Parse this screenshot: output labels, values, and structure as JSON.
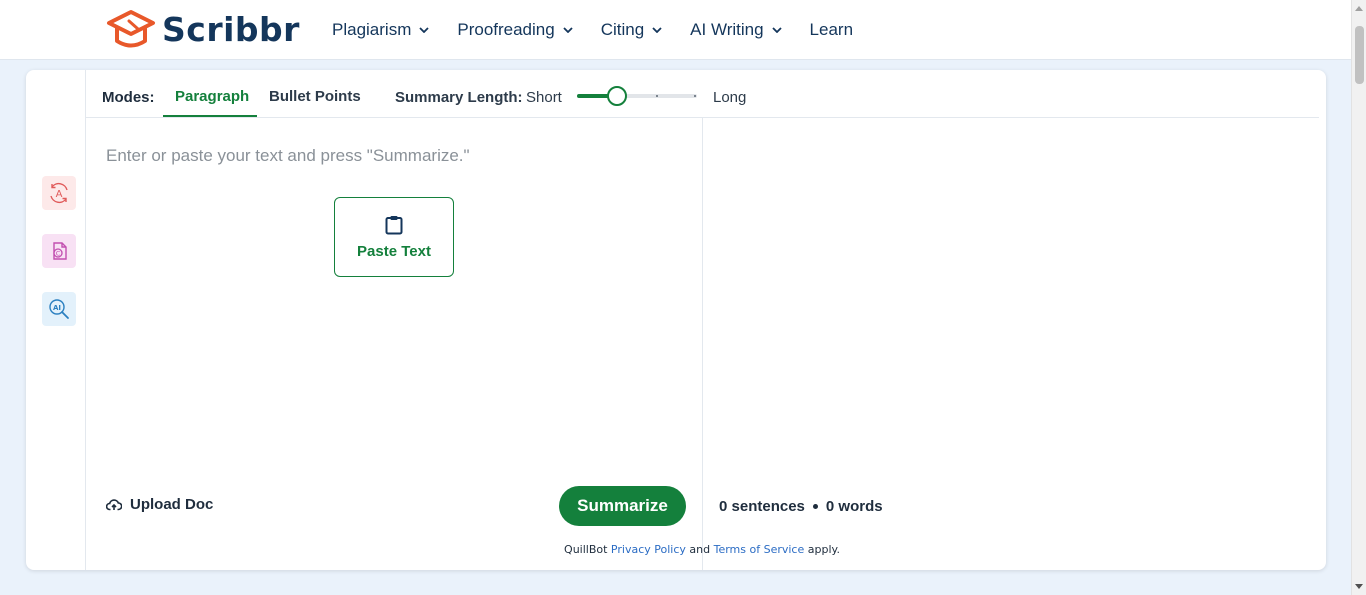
{
  "brand": {
    "name": "Scribbr",
    "logo_color": "#e8582a",
    "text_color": "#14365b"
  },
  "nav": [
    {
      "label": "Plagiarism",
      "has_dropdown": true
    },
    {
      "label": "Proofreading",
      "has_dropdown": true
    },
    {
      "label": "Citing",
      "has_dropdown": true
    },
    {
      "label": "AI Writing",
      "has_dropdown": true
    },
    {
      "label": "Learn",
      "has_dropdown": false
    }
  ],
  "rail": [
    {
      "icon": "paraphrase-icon",
      "color": "#e05a5a"
    },
    {
      "icon": "citation-doc-icon",
      "color": "#c24fb0"
    },
    {
      "icon": "ai-detector-icon",
      "color": "#2a7fc0"
    }
  ],
  "modes": {
    "label": "Modes:",
    "tabs": [
      {
        "label": "Paragraph",
        "active": true
      },
      {
        "label": "Bullet Points",
        "active": false
      }
    ]
  },
  "summary_length": {
    "label": "Summary Length:",
    "min_label": "Short",
    "max_label": "Long",
    "value_fraction": 0.33,
    "accent": "#14803c"
  },
  "input": {
    "placeholder": "Enter or paste your text and press \"Summarize.\"",
    "paste_label": "Paste Text",
    "upload_label": "Upload Doc",
    "summarize_label": "Summarize"
  },
  "output": {
    "sentences": "0 sentences",
    "words": "0 words"
  },
  "footer": {
    "prefix": "QuillBot",
    "privacy": "Privacy Policy",
    "and": "and",
    "terms": "Terms of Service",
    "suffix": "apply."
  }
}
